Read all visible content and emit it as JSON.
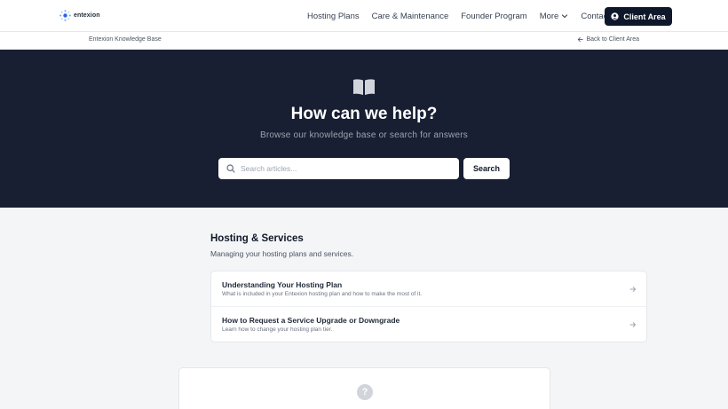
{
  "brand": {
    "name": "entexion"
  },
  "nav": {
    "links": [
      "Hosting Plans",
      "Care & Maintenance",
      "Founder Program",
      "More",
      "Contact"
    ],
    "client_area": "Client Area"
  },
  "subbar": {
    "kb_name": "Entexion Knowledge Base",
    "back_link": "Back to Client Area"
  },
  "hero": {
    "title": "How can we help?",
    "subtitle": "Browse our knowledge base or search for answers",
    "search_placeholder": "Search articles...",
    "search_button": "Search"
  },
  "section": {
    "title": "Hosting & Services",
    "description": "Managing your hosting plans and services.",
    "articles": [
      {
        "title": "Understanding Your Hosting Plan",
        "description": "What is included in your Entexion hosting plan and how to make the most of it."
      },
      {
        "title": "How to Request a Service Upgrade or Downgrade",
        "description": "Learn how to change your hosting plan tier."
      }
    ]
  },
  "help": {
    "icon_glyph": "?"
  },
  "colors": {
    "hero_bg": "#181f33",
    "button_dark": "#0f172a",
    "accent_logo": "#2563eb"
  }
}
